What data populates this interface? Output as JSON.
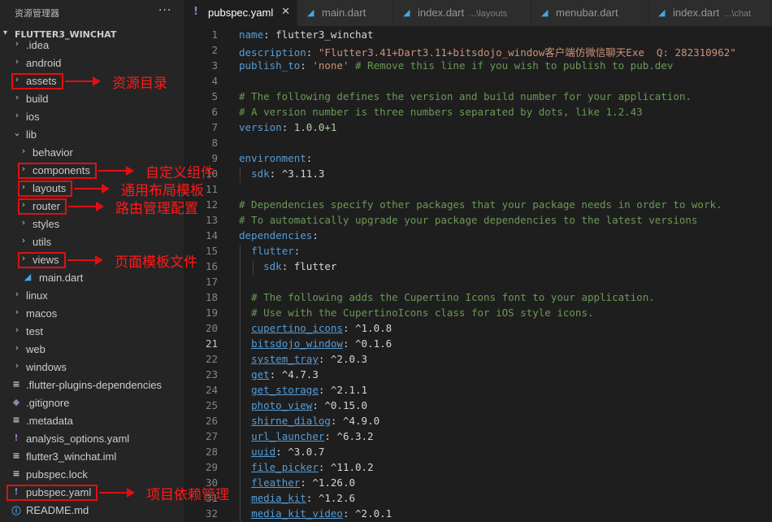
{
  "sidebar": {
    "title": "资源管理器",
    "more_icon": "more-icon",
    "project": "FLUTTER3_WINCHAT",
    "items": [
      {
        "label": ".idea",
        "type": "folder",
        "depth": 0
      },
      {
        "label": "android",
        "type": "folder",
        "depth": 0
      },
      {
        "label": "assets",
        "type": "folder",
        "depth": 0
      },
      {
        "label": "build",
        "type": "folder",
        "depth": 0
      },
      {
        "label": "ios",
        "type": "folder",
        "depth": 0
      },
      {
        "label": "lib",
        "type": "folder",
        "depth": 0
      },
      {
        "label": "behavior",
        "type": "folder",
        "depth": 1
      },
      {
        "label": "components",
        "type": "folder",
        "depth": 1
      },
      {
        "label": "layouts",
        "type": "folder",
        "depth": 1
      },
      {
        "label": "router",
        "type": "folder",
        "depth": 1
      },
      {
        "label": "styles",
        "type": "folder",
        "depth": 1
      },
      {
        "label": "utils",
        "type": "folder",
        "depth": 1
      },
      {
        "label": "views",
        "type": "folder",
        "depth": 1
      },
      {
        "label": "main.dart",
        "type": "dart",
        "depth": 1
      },
      {
        "label": "linux",
        "type": "folder",
        "depth": 0
      },
      {
        "label": "macos",
        "type": "folder",
        "depth": 0
      },
      {
        "label": "test",
        "type": "folder",
        "depth": 0
      },
      {
        "label": "web",
        "type": "folder",
        "depth": 0
      },
      {
        "label": "windows",
        "type": "folder",
        "depth": 0
      },
      {
        "label": ".flutter-plugins-dependencies",
        "type": "lines",
        "depth": 0
      },
      {
        "label": ".gitignore",
        "type": "git",
        "depth": 0
      },
      {
        "label": ".metadata",
        "type": "lines",
        "depth": 0
      },
      {
        "label": "analysis_options.yaml",
        "type": "yaml",
        "depth": 0
      },
      {
        "label": "flutter3_winchat.iml",
        "type": "lines",
        "depth": 0
      },
      {
        "label": "pubspec.lock",
        "type": "lines",
        "depth": 0
      },
      {
        "label": "pubspec.yaml",
        "type": "yaml",
        "depth": 0
      },
      {
        "label": "README.md",
        "type": "info",
        "depth": 0
      }
    ]
  },
  "tabs": [
    {
      "name": "pubspec.yaml",
      "path": "",
      "icon": "yaml-icon",
      "active": true
    },
    {
      "name": "main.dart",
      "path": "",
      "icon": "dart-icon",
      "active": false
    },
    {
      "name": "index.dart",
      "path": "...\\layouts",
      "icon": "dart-icon",
      "active": false
    },
    {
      "name": "menubar.dart",
      "path": "",
      "icon": "dart-icon",
      "active": false
    },
    {
      "name": "index.dart",
      "path": "...\\chat",
      "icon": "dart-icon",
      "active": false
    }
  ],
  "editor": {
    "current_line": 21,
    "lines": [
      [
        [
          "k",
          "name"
        ],
        [
          "p",
          ": flutter3_winchat"
        ]
      ],
      [
        [
          "k",
          "description"
        ],
        [
          "p",
          ": "
        ],
        [
          "s",
          "\"Flutter3.41+Dart3.11+bitsdojo_window客户端仿微信聊天Exe  Q: 282310962\""
        ]
      ],
      [
        [
          "k",
          "publish_to"
        ],
        [
          "p",
          ": "
        ],
        [
          "s",
          "'none'"
        ],
        [
          "c",
          " # Remove this line if you wish to publish to pub.dev"
        ]
      ],
      [],
      [
        [
          "c",
          "# The following defines the version and build number for your application."
        ]
      ],
      [
        [
          "c",
          "# A version number is three numbers separated by dots, like 1.2.43"
        ]
      ],
      [
        [
          "k",
          "version"
        ],
        [
          "p",
          ": "
        ],
        [
          "n",
          "1.0.0+1"
        ]
      ],
      [],
      [
        [
          "k",
          "environment"
        ],
        [
          "p",
          ":"
        ]
      ],
      [
        [
          "p",
          "  "
        ],
        [
          "k",
          "sdk"
        ],
        [
          "p",
          ": ^3.11.3"
        ]
      ],
      [],
      [
        [
          "c",
          "# Dependencies specify other packages that your package needs in order to work."
        ]
      ],
      [
        [
          "c",
          "# To automatically upgrade your package dependencies to the latest versions"
        ]
      ],
      [
        [
          "k",
          "dependencies"
        ],
        [
          "p",
          ":"
        ]
      ],
      [
        [
          "p",
          "  "
        ],
        [
          "k",
          "flutter"
        ],
        [
          "p",
          ":"
        ]
      ],
      [
        [
          "p",
          "    "
        ],
        [
          "k",
          "sdk"
        ],
        [
          "p",
          ": flutter"
        ]
      ],
      [],
      [
        [
          "p",
          "  "
        ],
        [
          "c",
          "# The following adds the Cupertino Icons font to your application."
        ]
      ],
      [
        [
          "p",
          "  "
        ],
        [
          "c",
          "# Use with the CupertinoIcons class for iOS style icons."
        ]
      ],
      [
        [
          "p",
          "  "
        ],
        [
          "u",
          "cupertino_icons"
        ],
        [
          "p",
          ": ^1.0.8"
        ]
      ],
      [
        [
          "p",
          "  "
        ],
        [
          "u",
          "bitsdojo_window"
        ],
        [
          "p",
          ": ^0.1.6"
        ]
      ],
      [
        [
          "p",
          "  "
        ],
        [
          "u",
          "system_tray"
        ],
        [
          "p",
          ": ^2.0.3"
        ]
      ],
      [
        [
          "p",
          "  "
        ],
        [
          "u",
          "get"
        ],
        [
          "p",
          ": ^4.7.3"
        ]
      ],
      [
        [
          "p",
          "  "
        ],
        [
          "u",
          "get_storage"
        ],
        [
          "p",
          ": ^2.1.1"
        ]
      ],
      [
        [
          "p",
          "  "
        ],
        [
          "u",
          "photo_view"
        ],
        [
          "p",
          ": ^0.15.0"
        ]
      ],
      [
        [
          "p",
          "  "
        ],
        [
          "u",
          "shirne_dialog"
        ],
        [
          "p",
          ": ^4.9.0"
        ]
      ],
      [
        [
          "p",
          "  "
        ],
        [
          "u",
          "url_launcher"
        ],
        [
          "p",
          ": ^6.3.2"
        ]
      ],
      [
        [
          "p",
          "  "
        ],
        [
          "u",
          "uuid"
        ],
        [
          "p",
          ": ^3.0.7"
        ]
      ],
      [
        [
          "p",
          "  "
        ],
        [
          "u",
          "file_picker"
        ],
        [
          "p",
          ": ^11.0.2"
        ]
      ],
      [
        [
          "p",
          "  "
        ],
        [
          "u",
          "fleather"
        ],
        [
          "p",
          ": ^1.26.0"
        ]
      ],
      [
        [
          "p",
          "  "
        ],
        [
          "u",
          "media_kit"
        ],
        [
          "p",
          ": ^1.2.6"
        ]
      ],
      [
        [
          "p",
          "  "
        ],
        [
          "u",
          "media_kit_video"
        ],
        [
          "p",
          ": ^2.0.1"
        ]
      ]
    ]
  },
  "annotations": [
    {
      "target": "assets",
      "text": "资源目录"
    },
    {
      "target": "components",
      "text": "自定义组件"
    },
    {
      "target": "layouts",
      "text": "通用布局模板"
    },
    {
      "target": "router",
      "text": "路由管理配置"
    },
    {
      "target": "views",
      "text": "页面模板文件"
    },
    {
      "target": "pubspec.yaml",
      "text": "项目依赖管理"
    }
  ],
  "colors": {
    "sidebar_bg": "#252526",
    "editor_bg": "#1e1e1e",
    "annotation": "#e01010",
    "keyword": "#569cd6",
    "string": "#ce9178",
    "comment": "#6a9955",
    "number": "#b5cea8",
    "yaml_icon": "#a074c4",
    "dart_icon": "#40a9e0"
  }
}
